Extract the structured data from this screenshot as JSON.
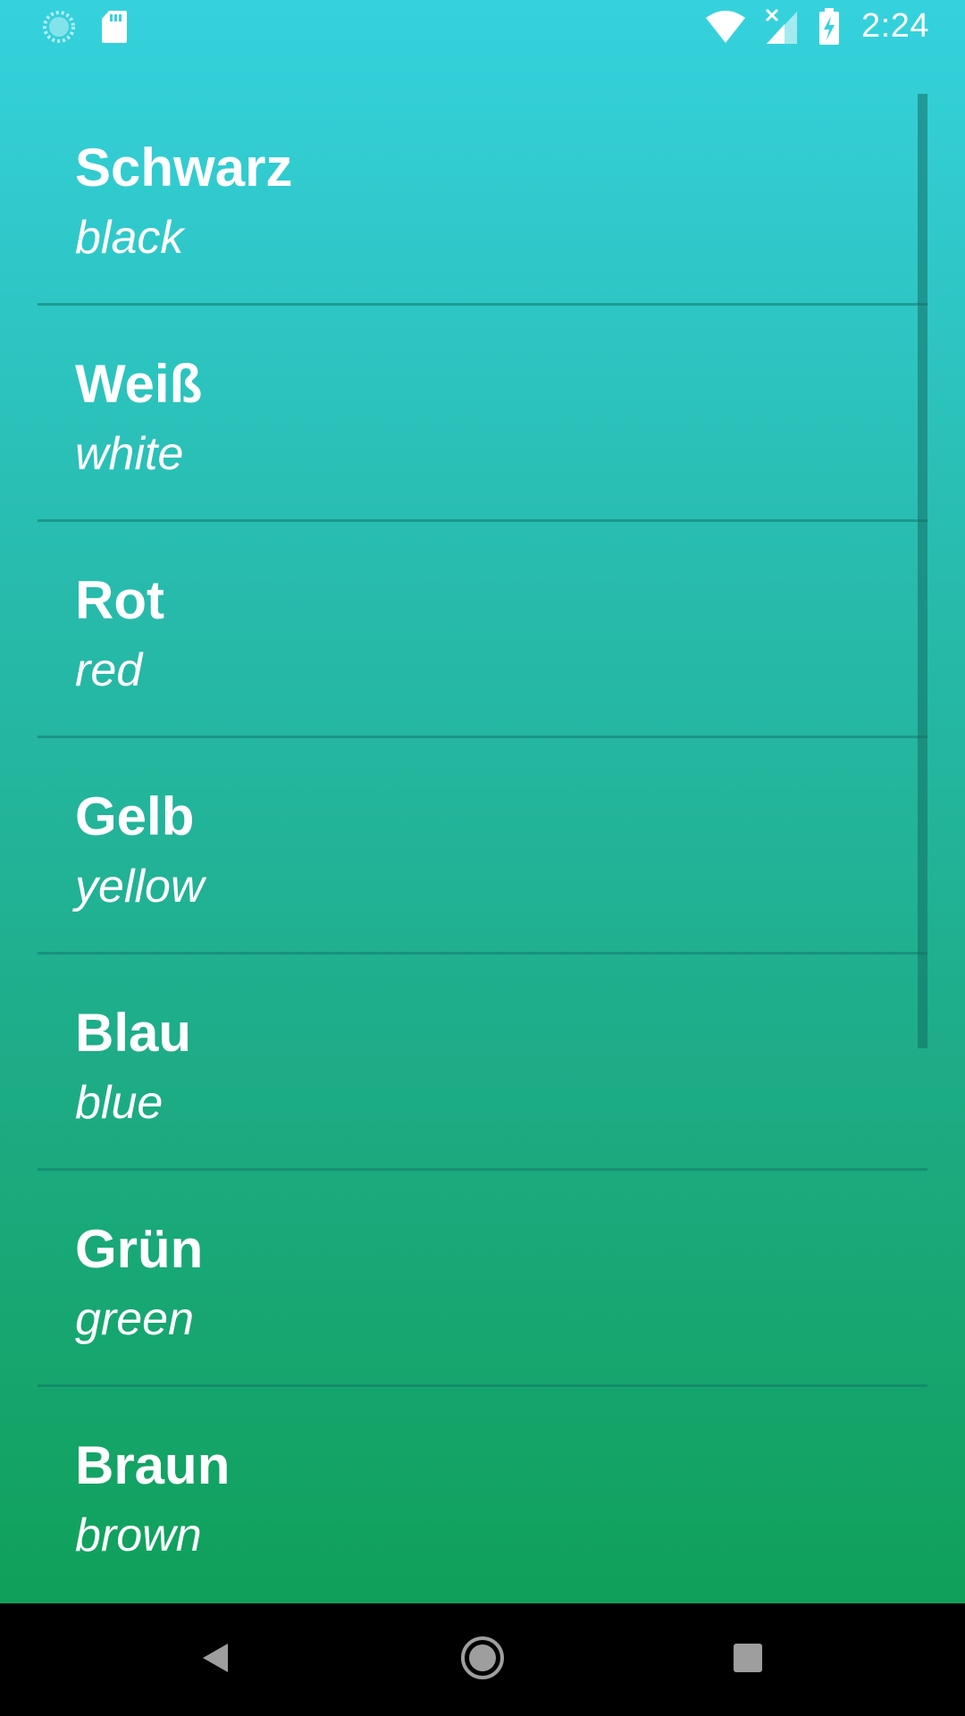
{
  "status_bar": {
    "time": "2:24",
    "left_icons": [
      "sync-spinner-icon",
      "sd-card-icon"
    ],
    "right_icons": [
      "wifi-icon",
      "cellular-no-signal-icon",
      "battery-charging-icon"
    ]
  },
  "words": [
    {
      "german": "Schwarz",
      "english": "black"
    },
    {
      "german": "Weiß",
      "english": "white"
    },
    {
      "german": "Rot",
      "english": "red"
    },
    {
      "german": "Gelb",
      "english": "yellow"
    },
    {
      "german": "Blau",
      "english": "blue"
    },
    {
      "german": "Grün",
      "english": "green"
    },
    {
      "german": "Braun",
      "english": "brown"
    }
  ],
  "nav_bar": {
    "buttons": [
      "back-icon",
      "home-icon",
      "recents-icon"
    ]
  },
  "colors": {
    "gradient_top": "#35d2de",
    "gradient_bottom": "#10a05a",
    "divider": "#1e7f76",
    "nav_background": "#000000"
  }
}
